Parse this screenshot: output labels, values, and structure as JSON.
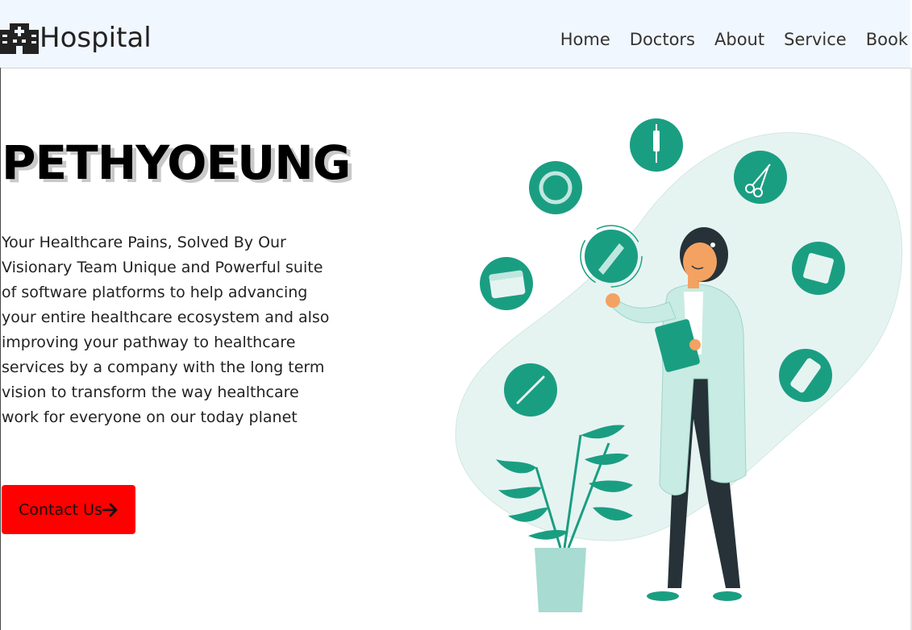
{
  "header": {
    "brand": "Hospital",
    "logo_icon": "hospital-building-icon",
    "nav": [
      {
        "label": "Home"
      },
      {
        "label": "Doctors"
      },
      {
        "label": "About"
      },
      {
        "label": "Service"
      },
      {
        "label": "Book"
      }
    ]
  },
  "hero": {
    "title": "PETHYOEUNG",
    "description": "Your Healthcare Pains, Solved By Our Visionary Team Unique and Powerful suite of software platforms to help advancing your entire healthcare ecosystem and also improving your pathway to healthcare services by a company with the long term vision to transform the way healthcare work for everyone on our today planet",
    "cta_label": "Contact Us",
    "cta_icon": "arrow-right-icon"
  },
  "colors": {
    "header_bg": "#f1f7fe",
    "accent": "#1a9e82",
    "cta": "#ff0000",
    "blob": "#e6f4f1"
  }
}
